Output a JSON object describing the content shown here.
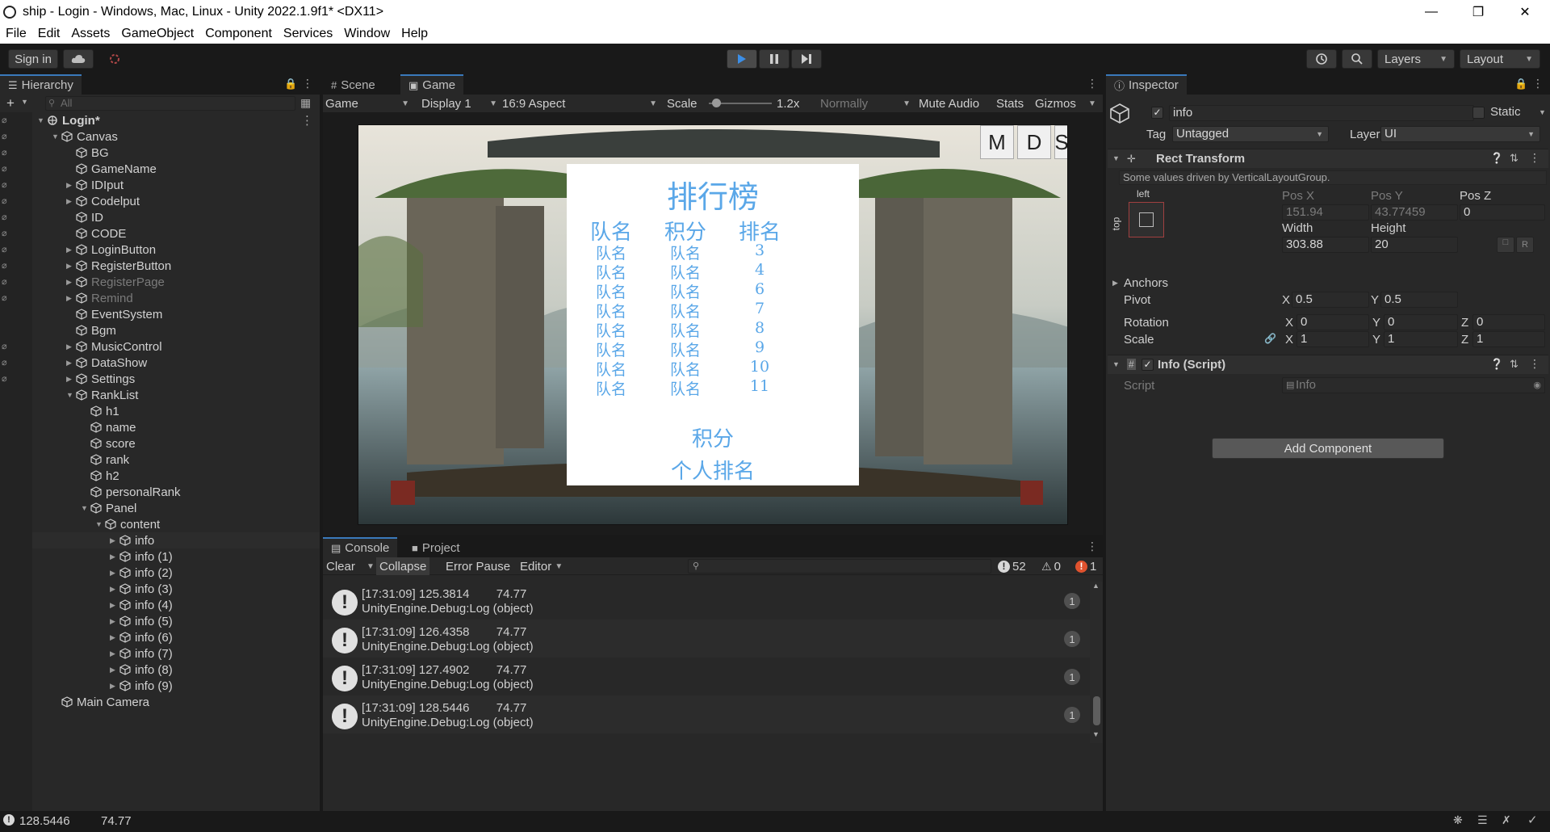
{
  "window": {
    "title": "ship - Login - Windows, Mac, Linux - Unity 2022.1.9f1* <DX11>"
  },
  "menu": [
    "File",
    "Edit",
    "Assets",
    "GameObject",
    "Component",
    "Services",
    "Window",
    "Help"
  ],
  "toolbar": {
    "sign_in": "Sign in",
    "layers": "Layers",
    "layout": "Layout"
  },
  "hierarchy": {
    "tab": "Hierarchy",
    "search_placeholder": "All",
    "rows": [
      {
        "label": "Login*",
        "depth": 0,
        "arrow": "open",
        "scene": true
      },
      {
        "label": "Canvas",
        "depth": 1,
        "arrow": "open"
      },
      {
        "label": "BG",
        "depth": 2,
        "arrow": ""
      },
      {
        "label": "GameName",
        "depth": 2,
        "arrow": ""
      },
      {
        "label": "IDIput",
        "depth": 2,
        "arrow": "closed"
      },
      {
        "label": "Codelput",
        "depth": 2,
        "arrow": "closed"
      },
      {
        "label": "ID",
        "depth": 2,
        "arrow": ""
      },
      {
        "label": "CODE",
        "depth": 2,
        "arrow": ""
      },
      {
        "label": "LoginButton",
        "depth": 2,
        "arrow": "closed"
      },
      {
        "label": "RegisterButton",
        "depth": 2,
        "arrow": "closed"
      },
      {
        "label": "RegisterPage",
        "depth": 2,
        "arrow": "closed",
        "dim": true
      },
      {
        "label": "Remind",
        "depth": 2,
        "arrow": "closed",
        "dim": true
      },
      {
        "label": "EventSystem",
        "depth": 2,
        "arrow": ""
      },
      {
        "label": "Bgm",
        "depth": 2,
        "arrow": ""
      },
      {
        "label": "MusicControl",
        "depth": 2,
        "arrow": "closed"
      },
      {
        "label": "DataShow",
        "depth": 2,
        "arrow": "closed"
      },
      {
        "label": "Settings",
        "depth": 2,
        "arrow": "closed"
      },
      {
        "label": "RankList",
        "depth": 2,
        "arrow": "open"
      },
      {
        "label": "h1",
        "depth": 3,
        "arrow": ""
      },
      {
        "label": "name",
        "depth": 3,
        "arrow": ""
      },
      {
        "label": "score",
        "depth": 3,
        "arrow": ""
      },
      {
        "label": "rank",
        "depth": 3,
        "arrow": ""
      },
      {
        "label": "h2",
        "depth": 3,
        "arrow": ""
      },
      {
        "label": "personalRank",
        "depth": 3,
        "arrow": ""
      },
      {
        "label": "Panel",
        "depth": 3,
        "arrow": "open"
      },
      {
        "label": "content",
        "depth": 4,
        "arrow": "open"
      },
      {
        "label": "info",
        "depth": 5,
        "arrow": "closed",
        "selected": true
      },
      {
        "label": "info (1)",
        "depth": 5,
        "arrow": "closed"
      },
      {
        "label": "info (2)",
        "depth": 5,
        "arrow": "closed"
      },
      {
        "label": "info (3)",
        "depth": 5,
        "arrow": "closed"
      },
      {
        "label": "info (4)",
        "depth": 5,
        "arrow": "closed"
      },
      {
        "label": "info (5)",
        "depth": 5,
        "arrow": "closed"
      },
      {
        "label": "info (6)",
        "depth": 5,
        "arrow": "closed"
      },
      {
        "label": "info (7)",
        "depth": 5,
        "arrow": "closed"
      },
      {
        "label": "info (8)",
        "depth": 5,
        "arrow": "closed"
      },
      {
        "label": "info (9)",
        "depth": 5,
        "arrow": "closed"
      },
      {
        "label": "Main Camera",
        "depth": 1,
        "arrow": ""
      }
    ]
  },
  "game": {
    "tabs": [
      "Scene",
      "Game"
    ],
    "mode": "Game",
    "display": "Display 1",
    "aspect": "16:9 Aspect",
    "scale_label": "Scale",
    "scale_value": "1.2x",
    "normally": "Normally",
    "mute": "Mute Audio",
    "stats": "Stats",
    "gizmos": "Gizmos",
    "buttons": [
      "M",
      "D",
      "S"
    ],
    "rank": {
      "title": "排行榜",
      "headers": [
        "队名",
        "积分",
        "排名"
      ],
      "rows": [
        [
          "队名",
          "队名",
          "3"
        ],
        [
          "队名",
          "队名",
          "4"
        ],
        [
          "队名",
          "队名",
          "6"
        ],
        [
          "队名",
          "队名",
          "7"
        ],
        [
          "队名",
          "队名",
          "8"
        ],
        [
          "队名",
          "队名",
          "9"
        ],
        [
          "队名",
          "队名",
          "10"
        ],
        [
          "队名",
          "队名",
          "11"
        ]
      ],
      "score": "积分",
      "personal_rank": "个人排名"
    }
  },
  "console": {
    "tabs": [
      "Console",
      "Project"
    ],
    "clear": "Clear",
    "collapse": "Collapse",
    "error_pause": "Error Pause",
    "editor": "Editor",
    "counts": {
      "log": "52",
      "warn": "0",
      "error": "1"
    },
    "entries": [
      {
        "line1": "[17:31:09] 125.3814        74.77",
        "line2": "UnityEngine.Debug:Log (object)",
        "count": "1"
      },
      {
        "line1": "[17:31:09] 126.4358        74.77",
        "line2": "UnityEngine.Debug:Log (object)",
        "count": "1"
      },
      {
        "line1": "[17:31:09] 127.4902        74.77",
        "line2": "UnityEngine.Debug:Log (object)",
        "count": "1"
      },
      {
        "line1": "[17:31:09] 128.5446        74.77",
        "line2": "UnityEngine.Debug:Log (object)",
        "count": "1"
      }
    ]
  },
  "inspector": {
    "tab": "Inspector",
    "name": "info",
    "static": "Static",
    "tag_label": "Tag",
    "tag": "Untagged",
    "layer_label": "Layer",
    "layer": "UI",
    "rect_transform": "Rect Transform",
    "driven_note": "Some values driven by VerticalLayoutGroup.",
    "anchor_h": "left",
    "anchor_v": "top",
    "pos_x_label": "Pos X",
    "pos_x": "151.94",
    "pos_y_label": "Pos Y",
    "pos_y": "43.77459",
    "pos_z_label": "Pos Z",
    "pos_z": "0",
    "width_label": "Width",
    "width": "303.88",
    "height_label": "Height",
    "height": "20",
    "anchors": "Anchors",
    "pivot": "Pivot",
    "pivot_x": "0.5",
    "pivot_y": "0.5",
    "rotation": "Rotation",
    "rot_x": "0",
    "rot_y": "0",
    "rot_z": "0",
    "scale": "Scale",
    "scale_x": "1",
    "scale_y": "1",
    "scale_z": "1",
    "script_component": "Info (Script)",
    "script_label": "Script",
    "script_value": "Info",
    "add_component": "Add Component"
  },
  "status": {
    "value1": "128.5446",
    "value2": "74.77"
  },
  "colors": {
    "accent": "#3a79bb",
    "play": "#3c8ee6",
    "rank_text": "#5aa7e8"
  }
}
